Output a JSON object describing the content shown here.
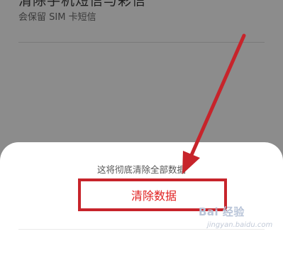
{
  "background": {
    "title": "清除手机短信与彩信",
    "subtitle": "会保留 SIM 卡短信"
  },
  "sheet": {
    "message": "这将彻底清除全部数据",
    "confirm_button": "清除数据"
  },
  "watermark": {
    "main": "Bai 经验",
    "sub": "jingyan.baidu.com"
  },
  "colors": {
    "danger_text": "#e02020",
    "annotation": "#c7242b",
    "dim_overlay": "#8c8c8c"
  }
}
